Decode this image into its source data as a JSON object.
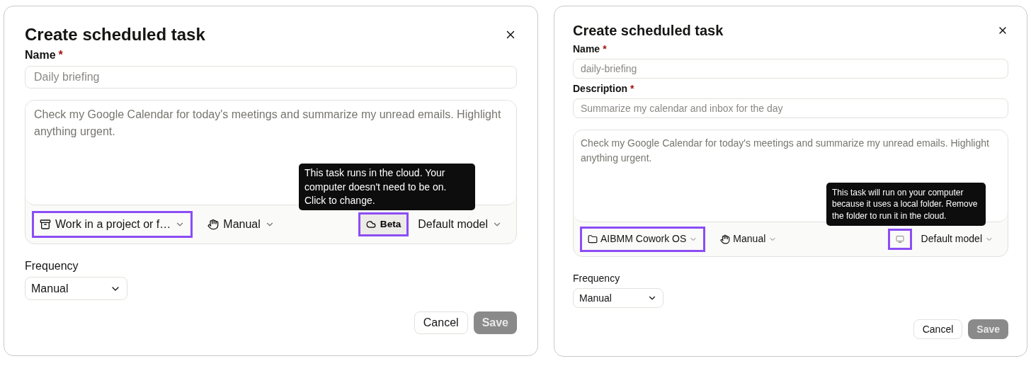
{
  "dialogs": [
    {
      "kind": "large",
      "title": "Create scheduled task",
      "fields": [
        {
          "label": "Name",
          "required_mark": "*",
          "placeholder": "Daily briefing"
        }
      ],
      "prompt": {
        "placeholder": "Check my Google Calendar for today's meetings and summarize my unread emails. Highlight anything urgent."
      },
      "toolbar": {
        "folder": {
          "kind": "project",
          "label": "Work in a project or f…",
          "highlighted": true
        },
        "permission": {
          "label": "Manual"
        },
        "location": {
          "kind": "cloud",
          "label": "Beta",
          "highlighted": true,
          "tooltip": "This task runs in the cloud. Your computer doesn't need to be on. Click to change."
        },
        "model": {
          "label": "Default model"
        }
      },
      "frequency": {
        "label": "Frequency",
        "value": "Manual"
      },
      "buttons": {
        "cancel": {
          "label": "Cancel"
        },
        "save": {
          "label": "Save",
          "disabled": true
        }
      }
    },
    {
      "kind": "compact",
      "title": "Create scheduled task",
      "fields": [
        {
          "label": "Name",
          "required_mark": "*",
          "placeholder": "daily-briefing"
        },
        {
          "label": "Description",
          "required_mark": "*",
          "placeholder": "Summarize my calendar and inbox for the day"
        }
      ],
      "prompt": {
        "placeholder": "Check my Google Calendar for today's meetings and summarize my unread emails. Highlight anything urgent."
      },
      "toolbar": {
        "folder": {
          "kind": "folder",
          "label": "AIBMM Cowork OS",
          "highlighted": true
        },
        "permission": {
          "label": "Manual"
        },
        "location": {
          "kind": "computer",
          "highlighted": true,
          "tooltip": "This task will run on your computer because it uses a local folder. Remove the folder to run it in the cloud."
        },
        "model": {
          "label": "Default model"
        }
      },
      "frequency": {
        "label": "Frequency",
        "value": "Manual"
      },
      "buttons": {
        "cancel": {
          "label": "Cancel"
        },
        "save": {
          "label": "Save",
          "disabled": true
        }
      }
    }
  ]
}
